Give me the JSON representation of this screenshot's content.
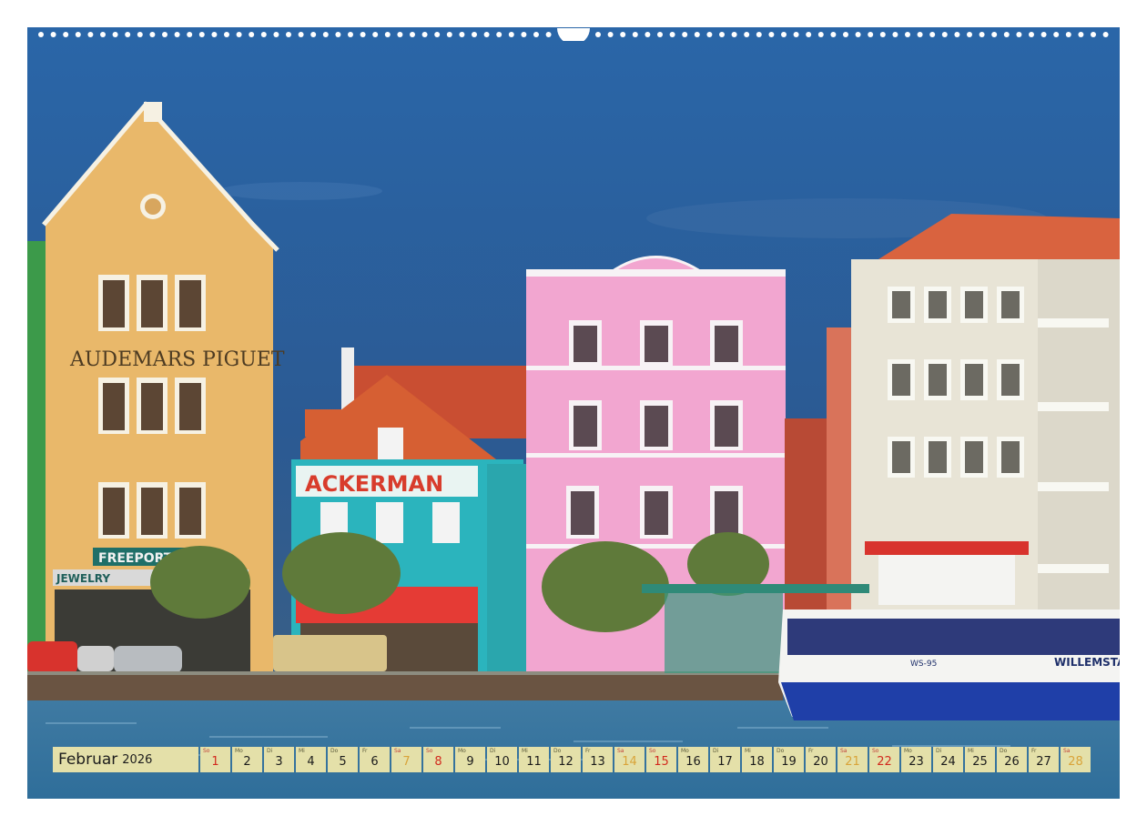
{
  "calendar": {
    "month": "Februar",
    "year": "2026",
    "days": [
      {
        "wd": "So",
        "n": "1",
        "type": "sun"
      },
      {
        "wd": "Mo",
        "n": "2",
        "type": "weekday"
      },
      {
        "wd": "Di",
        "n": "3",
        "type": "weekday"
      },
      {
        "wd": "Mi",
        "n": "4",
        "type": "weekday"
      },
      {
        "wd": "Do",
        "n": "5",
        "type": "weekday"
      },
      {
        "wd": "Fr",
        "n": "6",
        "type": "weekday"
      },
      {
        "wd": "Sa",
        "n": "7",
        "type": "sat"
      },
      {
        "wd": "So",
        "n": "8",
        "type": "sun"
      },
      {
        "wd": "Mo",
        "n": "9",
        "type": "weekday"
      },
      {
        "wd": "Di",
        "n": "10",
        "type": "weekday"
      },
      {
        "wd": "Mi",
        "n": "11",
        "type": "weekday"
      },
      {
        "wd": "Do",
        "n": "12",
        "type": "weekday"
      },
      {
        "wd": "Fr",
        "n": "13",
        "type": "weekday"
      },
      {
        "wd": "Sa",
        "n": "14",
        "type": "sat"
      },
      {
        "wd": "So",
        "n": "15",
        "type": "sun"
      },
      {
        "wd": "Mo",
        "n": "16",
        "type": "weekday"
      },
      {
        "wd": "Di",
        "n": "17",
        "type": "weekday"
      },
      {
        "wd": "Mi",
        "n": "18",
        "type": "weekday"
      },
      {
        "wd": "Do",
        "n": "19",
        "type": "weekday"
      },
      {
        "wd": "Fr",
        "n": "20",
        "type": "weekday"
      },
      {
        "wd": "Sa",
        "n": "21",
        "type": "sat"
      },
      {
        "wd": "So",
        "n": "22",
        "type": "sun"
      },
      {
        "wd": "Mo",
        "n": "23",
        "type": "weekday"
      },
      {
        "wd": "Di",
        "n": "24",
        "type": "weekday"
      },
      {
        "wd": "Mi",
        "n": "25",
        "type": "weekday"
      },
      {
        "wd": "Do",
        "n": "26",
        "type": "weekday"
      },
      {
        "wd": "Fr",
        "n": "27",
        "type": "weekday"
      },
      {
        "wd": "Sa",
        "n": "28",
        "type": "sat"
      }
    ]
  },
  "signs": {
    "audemars": "AUDEMARS PIGUET",
    "ackerman": "ACKERMAN",
    "freeport": "FREEPORT",
    "jewelry": "JEWELRY",
    "ferry": "WILLEMSTA",
    "ferry_id": "WS-95"
  },
  "colors": {
    "sky": "#2a5f9e",
    "water": "#4a80a8",
    "yellow_building": "#e9b86a",
    "pink_building": "#f2a6d0",
    "teal_building": "#2bb4bd",
    "calendar_bg": "#e4e0a9",
    "sunday": "#d22a1e",
    "saturday": "#d9a43a"
  }
}
